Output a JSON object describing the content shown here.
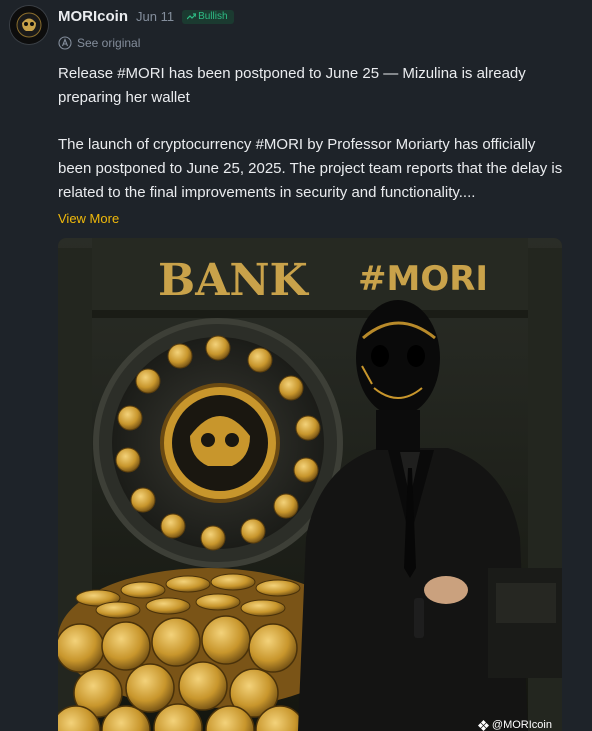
{
  "post": {
    "author": "MORIcoin",
    "date": "Jun 11",
    "sentiment": "Bullish",
    "see_original": "See original",
    "title": "Release #MORI has been postponed to June 25 — Mizulina is already preparing her wallet",
    "body": "The launch of cryptocurrency #MORI by Professor Moriarty has officially been postponed to June 25, 2025. The project team reports that the delay is related to the final improvements in security and functionality....",
    "view_more": "View More"
  },
  "image": {
    "sign_bank": "BANK",
    "sign_tag": "#MORI",
    "watermark": "@MORIcoin"
  },
  "colors": {
    "background": "#1e2329",
    "accent_yellow": "#f0b90b",
    "bullish_green": "#2ebd85",
    "muted_text": "#848e9c"
  },
  "icons": {
    "sentiment": "trend-up-icon",
    "translate": "translate-icon",
    "watermark": "binance-square-icon"
  }
}
